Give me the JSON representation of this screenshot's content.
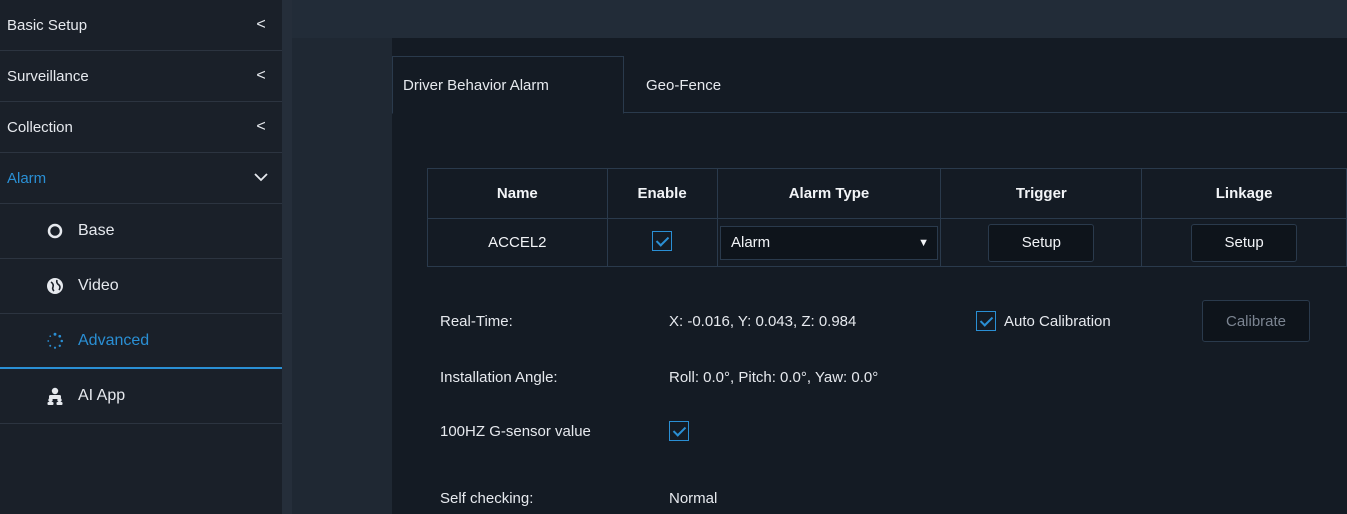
{
  "sidebar": {
    "items": [
      {
        "label": "Basic Setup",
        "chevron": "<"
      },
      {
        "label": "Surveillance",
        "chevron": "<"
      },
      {
        "label": "Collection",
        "chevron": "<"
      },
      {
        "label": "Alarm",
        "chevron": "∨"
      }
    ],
    "sub_items": [
      {
        "label": "Base",
        "icon": "circle-icon"
      },
      {
        "label": "Video",
        "icon": "globe-icon"
      },
      {
        "label": "Advanced",
        "icon": "dots-spinner-icon"
      },
      {
        "label": "AI App",
        "icon": "users-icon"
      }
    ]
  },
  "tabs": [
    {
      "label": "Driver Behavior Alarm",
      "active": true
    },
    {
      "label": "Geo-Fence",
      "active": false
    }
  ],
  "table": {
    "headers": [
      "Name",
      "Enable",
      "Alarm Type",
      "Trigger",
      "Linkage"
    ],
    "row": {
      "name": "ACCEL2",
      "enabled": true,
      "alarm_type": "Alarm",
      "trigger_button": "Setup",
      "linkage_button": "Setup"
    }
  },
  "realtime": {
    "label": "Real-Time:",
    "value": "X: -0.016, Y: 0.043, Z: 0.984",
    "auto_calibration_label": "Auto Calibration",
    "auto_calibration_checked": true,
    "calibrate_button": "Calibrate"
  },
  "installation": {
    "label": "Installation Angle:",
    "value": "Roll: 0.0°, Pitch: 0.0°, Yaw: 0.0°"
  },
  "gsensor": {
    "label": "100HZ G-sensor value",
    "checked": true
  },
  "self_check": {
    "label": "Self checking:",
    "value": "Normal"
  },
  "colors": {
    "accent": "#2a8fd4",
    "background": "#141b24",
    "sidebar": "#1a2029"
  }
}
